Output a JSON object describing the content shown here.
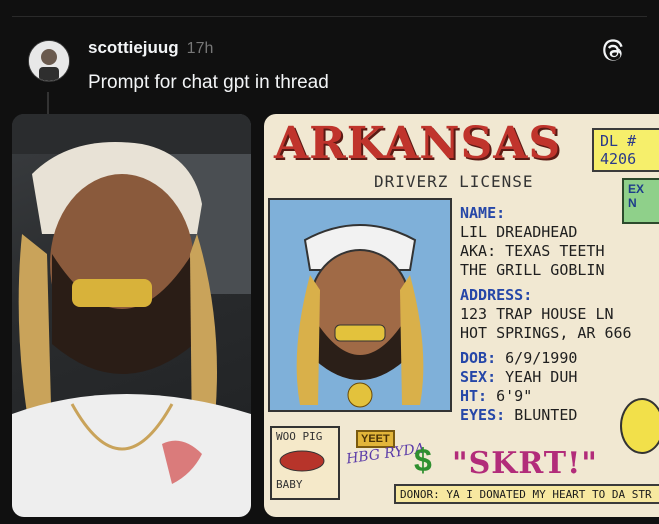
{
  "post": {
    "username": "scottiejuug",
    "timestamp": "17h",
    "text": "Prompt for chat gpt in thread"
  },
  "license_card": {
    "title": "ARKANSAS",
    "subtitle": "DRIVERZ LICENSE",
    "dl_label": "DL #",
    "dl_number": "4206",
    "exp_label": "EX",
    "exp_value": "N",
    "fields": [
      {
        "label": "NAME:",
        "value": ""
      },
      {
        "label": "",
        "value": "LIL DREADHEAD"
      },
      {
        "label": "",
        "value": "AKA: TEXAS TEETH"
      },
      {
        "label": "",
        "value": "THE GRILL GOBLIN"
      },
      {
        "label": "ADDRESS:",
        "value": ""
      },
      {
        "label": "",
        "value": "123 TRAP HOUSE LN"
      },
      {
        "label": "",
        "value": "HOT SPRINGS, AR 666"
      },
      {
        "label": "DOB:",
        "value": "6/9/1990"
      },
      {
        "label": "SEX:",
        "value": "YEAH DUH"
      },
      {
        "label": "HT:",
        "value": "6'9\""
      },
      {
        "label": "EYES:",
        "value": "BLUNTED"
      }
    ],
    "sign_top": "WOO PIG",
    "sign_bottom": "BABY",
    "yeet_tag": "YEET",
    "hbg_text": "HBG RYDA",
    "skrt_text": "\"SKRT!\"",
    "dollar": "$",
    "donor_text": "DONOR: YA I DONATED MY HEART TO DA STR"
  },
  "colors": {
    "background": "#101010",
    "text": "#f3f5f7",
    "muted": "#777777",
    "license_red": "#c0342c",
    "license_blue": "#2647a8"
  },
  "icons": {
    "brand": "threads-icon",
    "avatar": "avatar"
  }
}
